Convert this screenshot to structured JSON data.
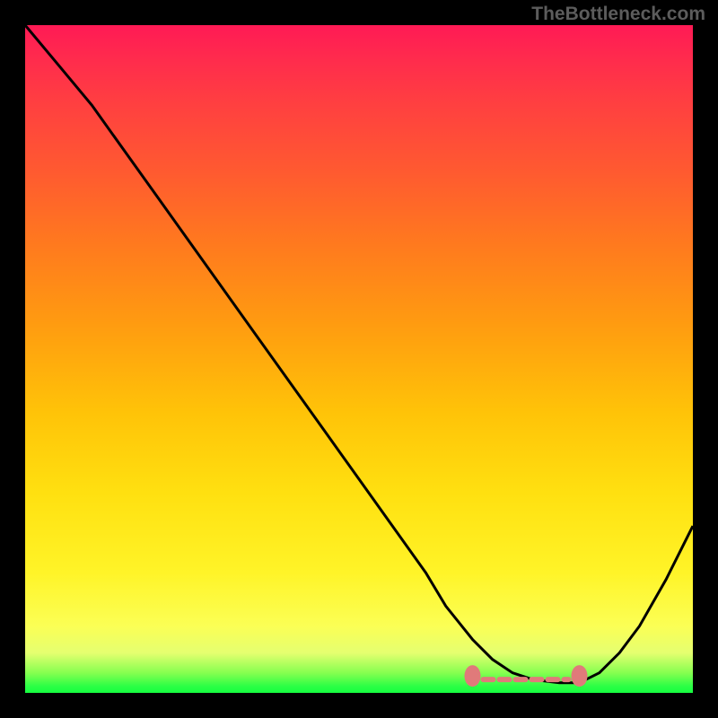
{
  "watermark": "TheBottleneck.com",
  "chart_data": {
    "type": "line",
    "title": "",
    "xlabel": "",
    "ylabel": "",
    "xlim": [
      0,
      100
    ],
    "ylim": [
      0,
      100
    ],
    "series": [
      {
        "name": "bottleneck-curve",
        "x": [
          0,
          5,
          10,
          15,
          20,
          25,
          30,
          35,
          40,
          45,
          50,
          55,
          60,
          63,
          67,
          70,
          73,
          76,
          80,
          83,
          86,
          89,
          92,
          96,
          100
        ],
        "y": [
          100,
          94,
          88,
          81,
          74,
          67,
          60,
          53,
          46,
          39,
          32,
          25,
          18,
          13,
          8,
          5,
          3,
          2,
          1.5,
          1.5,
          3,
          6,
          10,
          17,
          25
        ]
      }
    ],
    "highlight_region": {
      "x_start": 67,
      "x_end": 83,
      "y": 2
    },
    "gradient_stops": [
      {
        "pos": 0.0,
        "color": "#ff1a55"
      },
      {
        "pos": 0.05,
        "color": "#ff2b4d"
      },
      {
        "pos": 0.12,
        "color": "#ff4040"
      },
      {
        "pos": 0.22,
        "color": "#ff5a30"
      },
      {
        "pos": 0.33,
        "color": "#ff7a1e"
      },
      {
        "pos": 0.45,
        "color": "#ff9c10"
      },
      {
        "pos": 0.58,
        "color": "#ffc308"
      },
      {
        "pos": 0.7,
        "color": "#ffe010"
      },
      {
        "pos": 0.82,
        "color": "#fff428"
      },
      {
        "pos": 0.9,
        "color": "#fbff55"
      },
      {
        "pos": 0.94,
        "color": "#e5ff70"
      },
      {
        "pos": 0.97,
        "color": "#86ff50"
      },
      {
        "pos": 0.99,
        "color": "#2cff45"
      },
      {
        "pos": 1.0,
        "color": "#15ff40"
      }
    ],
    "colors": {
      "curve": "#000000",
      "highlight": "#e07a7a",
      "background_frame": "#000000"
    }
  }
}
